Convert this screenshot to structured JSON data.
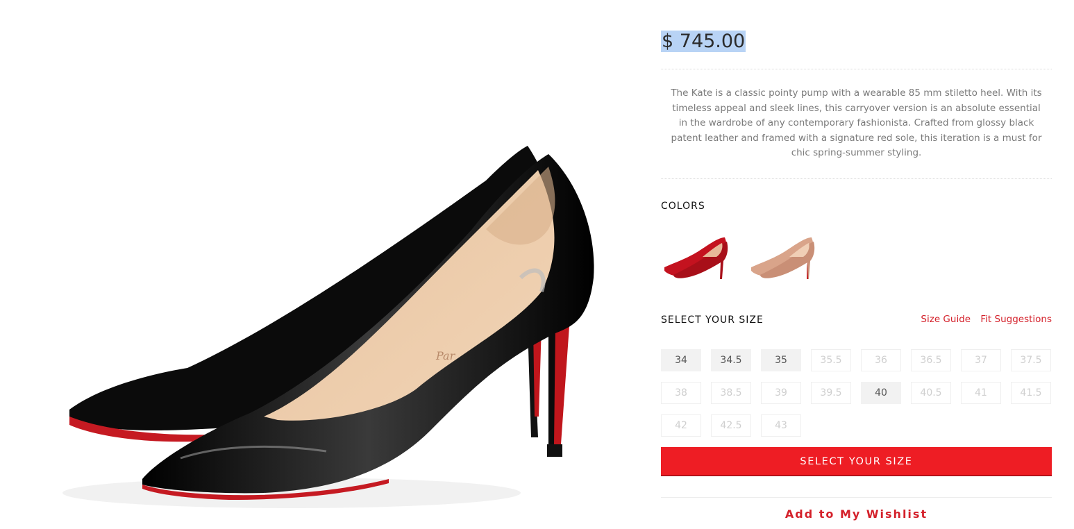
{
  "product": {
    "price": "$ 745.00",
    "description": "The Kate is a classic pointy pump with a wearable 85 mm stiletto heel. With its timeless appeal and sleek lines, this carryover version is an absolute essential in the wardrobe of any contemporary fashionista. Crafted from glossy black patent leather and framed with a signature red sole, this iteration is a must for chic spring-summer styling.",
    "image_insole_text": "Par"
  },
  "colors": {
    "heading": "COLORS",
    "swatches": [
      {
        "name": "red-patent-swatch",
        "color": "#c4121f"
      },
      {
        "name": "nude-patent-swatch",
        "color": "#d9a48a"
      }
    ]
  },
  "size": {
    "heading": "SELECT YOUR SIZE",
    "size_guide": "Size Guide",
    "fit_suggestions": "Fit Suggestions",
    "options": [
      {
        "label": "34",
        "available": true
      },
      {
        "label": "34.5",
        "available": true
      },
      {
        "label": "35",
        "available": true
      },
      {
        "label": "35.5",
        "available": false
      },
      {
        "label": "36",
        "available": false
      },
      {
        "label": "36.5",
        "available": false
      },
      {
        "label": "37",
        "available": false
      },
      {
        "label": "37.5",
        "available": false
      },
      {
        "label": "38",
        "available": false
      },
      {
        "label": "38.5",
        "available": false
      },
      {
        "label": "39",
        "available": false
      },
      {
        "label": "39.5",
        "available": false
      },
      {
        "label": "40",
        "available": true
      },
      {
        "label": "40.5",
        "available": false
      },
      {
        "label": "41",
        "available": false
      },
      {
        "label": "41.5",
        "available": false
      },
      {
        "label": "42",
        "available": false
      },
      {
        "label": "42.5",
        "available": false
      },
      {
        "label": "43",
        "available": false
      }
    ]
  },
  "actions": {
    "select_size_button": "SELECT YOUR SIZE",
    "wishlist": "Add to My Wishlist"
  },
  "theme": {
    "accent": "#ee1d24",
    "link": "#d4202a"
  }
}
